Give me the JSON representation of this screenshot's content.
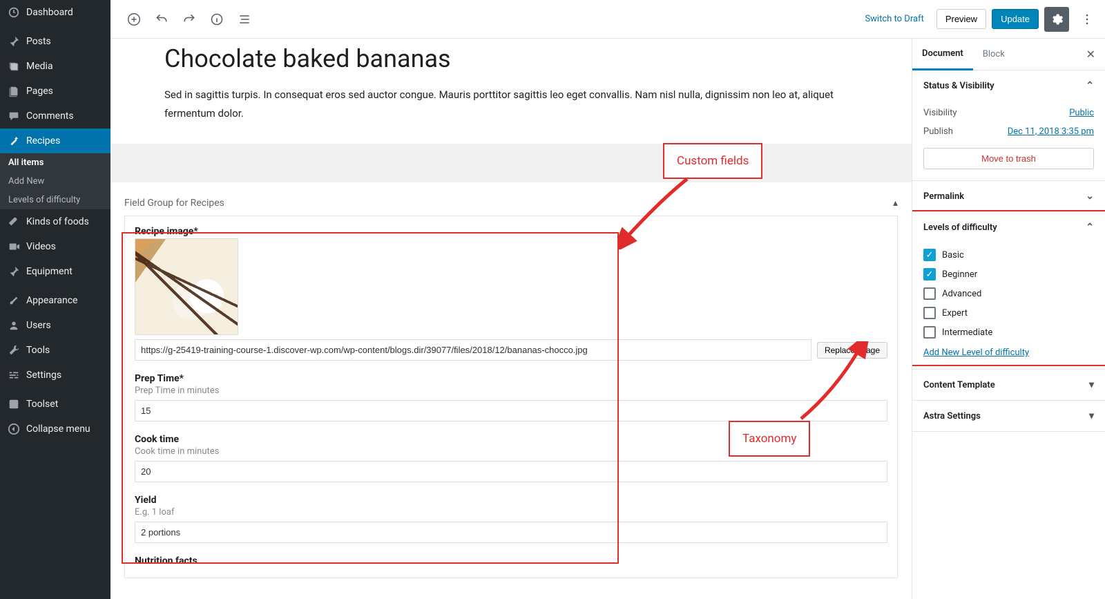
{
  "sidebar": {
    "items": [
      {
        "label": "Dashboard"
      },
      {
        "label": "Posts"
      },
      {
        "label": "Media"
      },
      {
        "label": "Pages"
      },
      {
        "label": "Comments"
      },
      {
        "label": "Recipes"
      },
      {
        "label": "Kinds of foods"
      },
      {
        "label": "Videos"
      },
      {
        "label": "Equipment"
      },
      {
        "label": "Appearance"
      },
      {
        "label": "Users"
      },
      {
        "label": "Tools"
      },
      {
        "label": "Settings"
      },
      {
        "label": "Toolset"
      },
      {
        "label": "Collapse menu"
      }
    ],
    "sub": [
      {
        "label": "All items"
      },
      {
        "label": "Add New"
      },
      {
        "label": "Levels of difficulty"
      }
    ]
  },
  "topbar": {
    "switch_draft": "Switch to Draft",
    "preview": "Preview",
    "update": "Update"
  },
  "post": {
    "title": "Chocolate baked bananas",
    "body": "Sed in sagittis turpis. In consequat eros sed auctor congue. Mauris porttitor sagittis leo eget convallis. Nam nisl nulla, dignissim non leo at, aliquet fermentum dolor."
  },
  "field_group": {
    "title": "Field Group for Recipes",
    "recipe_image_label": "Recipe image*",
    "image_url": "https://g-25419-training-course-1.discover-wp.com/wp-content/blogs.dir/39077/files/2018/12/bananas-chocco.jpg",
    "replace_image": "Replace image",
    "prep_label": "Prep Time*",
    "prep_desc": "Prep Time in minutes",
    "prep_value": "15",
    "cook_label": "Cook time",
    "cook_desc": "Cook time in minutes",
    "cook_value": "20",
    "yield_label": "Yield",
    "yield_desc": "E.g. 1 loaf",
    "yield_value": "2 portions",
    "nutrition_label": "Nutrition facts"
  },
  "doc": {
    "tab_document": "Document",
    "tab_block": "Block",
    "status_title": "Status & Visibility",
    "visibility_label": "Visibility",
    "visibility_value": "Public",
    "publish_label": "Publish",
    "publish_value": "Dec 11, 2018 3:35 pm",
    "trash": "Move to trash",
    "permalink_title": "Permalink",
    "levels_title": "Levels of difficulty",
    "levels": [
      {
        "label": "Basic",
        "checked": true
      },
      {
        "label": "Beginner",
        "checked": true
      },
      {
        "label": "Advanced",
        "checked": false
      },
      {
        "label": "Expert",
        "checked": false
      },
      {
        "label": "Intermediate",
        "checked": false
      }
    ],
    "add_level": "Add New Level of difficulty",
    "content_template_title": "Content Template",
    "astra_title": "Astra Settings"
  },
  "annotations": {
    "custom_fields": "Custom fields",
    "taxonomy": "Taxonomy"
  }
}
